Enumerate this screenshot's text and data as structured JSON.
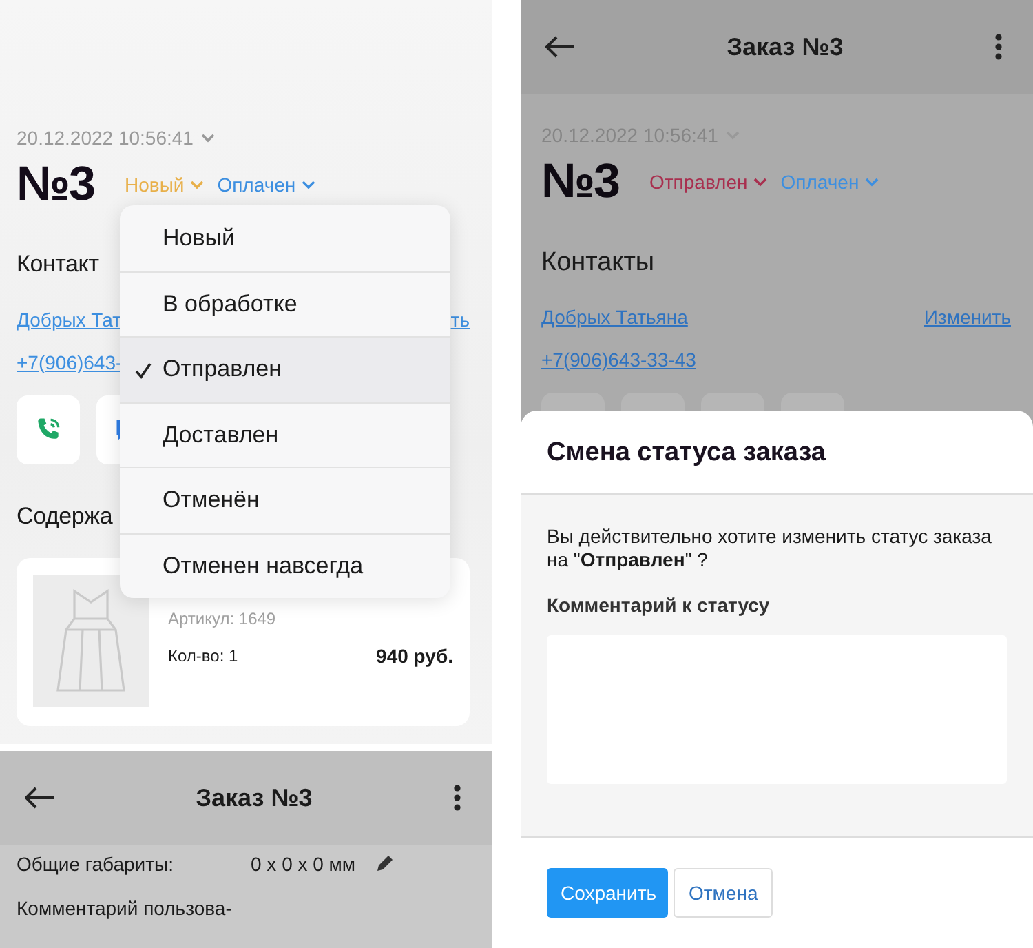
{
  "left_top": {
    "date": "20.12.2022 10:56:41",
    "order_number": "№3",
    "status": {
      "label": "Новый",
      "color": "#e8b04a"
    },
    "payment": {
      "label": "Оплачен",
      "color": "#3d8fe0"
    },
    "contacts_heading": "Контакт",
    "contact_name": "Добрых Тат",
    "contact_edit": "ть",
    "phone": "+7(906)643-",
    "actions": [
      {
        "kind": "call"
      },
      {
        "kind": "chat"
      }
    ],
    "contents_heading": "Содержа",
    "product": {
      "article": "Артикул: 1649",
      "quantity": "Кол-во: 1",
      "price": "940 руб."
    },
    "status_menu": [
      {
        "label": "Новый",
        "selected": false
      },
      {
        "label": "В обработке",
        "selected": false
      },
      {
        "label": "Отправлен",
        "selected": true
      },
      {
        "label": "Доставлен",
        "selected": false
      },
      {
        "label": "Отменён",
        "selected": false
      },
      {
        "label": "Отменен навсегда",
        "selected": false
      }
    ]
  },
  "left_bottom": {
    "title": "Заказ №3",
    "rows": [
      {
        "label": "Общие габариты:",
        "value": "0 x 0 x 0 мм",
        "editable": true
      },
      {
        "label": "Комментарий пользова-"
      }
    ]
  },
  "right": {
    "title": "Заказ №3",
    "date": "20.12.2022 10:56:41",
    "order_number": "№3",
    "status": {
      "label": "Отправлен",
      "color": "#a8304f"
    },
    "payment": {
      "label": "Оплачен",
      "color": "#3d8fe0"
    },
    "contacts_heading": "Контакты",
    "contact_name": "Добрых Татьяна",
    "contact_edit": "Изменить",
    "phone": "+7(906)643-33-43",
    "dialog": {
      "title": "Смена статуса заказа",
      "message": "Вы действительно хотите изменить статус заказа на \"**Отправлен**\" ?",
      "comment_label": "Комментарий к статусу",
      "buttons": [
        {
          "label": "Сохранить",
          "kind": "primary"
        },
        {
          "label": "Отмена",
          "kind": "secondary"
        }
      ]
    }
  }
}
